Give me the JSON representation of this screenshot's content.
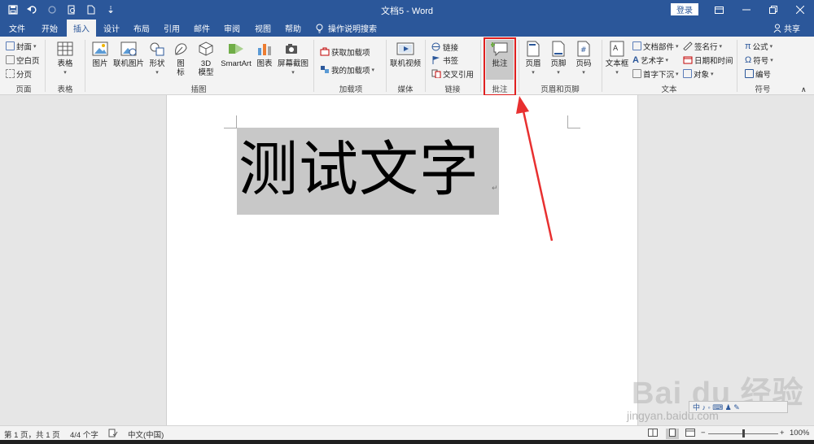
{
  "titlebar": {
    "doc_title": "文档5 - Word",
    "login_label": "登录",
    "qat": {
      "save": "save-icon",
      "undo": "undo-icon",
      "redo": "redo-icon",
      "print_preview": "print-preview-icon",
      "new": "new-doc-icon",
      "customize": "⇣"
    }
  },
  "tabs": [
    {
      "label": "文件",
      "active": false
    },
    {
      "label": "开始",
      "active": false
    },
    {
      "label": "插入",
      "active": true
    },
    {
      "label": "设计",
      "active": false
    },
    {
      "label": "布局",
      "active": false
    },
    {
      "label": "引用",
      "active": false
    },
    {
      "label": "邮件",
      "active": false
    },
    {
      "label": "审阅",
      "active": false
    },
    {
      "label": "视图",
      "active": false
    },
    {
      "label": "帮助",
      "active": false
    }
  ],
  "tell_me": "操作说明搜索",
  "share": "共享",
  "ribbon": {
    "pages": {
      "cover": "封面",
      "blank": "空白页",
      "break": "分页",
      "group": "页面"
    },
    "tables": {
      "table": "表格",
      "group": "表格"
    },
    "illustrations": {
      "picture": "图片",
      "online_picture": "联机图片",
      "shapes": "形状",
      "icons_l1": "图",
      "icons_l2": "标",
      "model_l1": "3D",
      "model_l2": "模型",
      "smartart": "SmartArt",
      "chart": "图表",
      "screenshot": "屏幕截图",
      "group": "插图"
    },
    "addins": {
      "get": "获取加载项",
      "mine": "我的加载项",
      "group": "加载项"
    },
    "media": {
      "online_video": "联机视频",
      "group": "媒体"
    },
    "links": {
      "link": "链接",
      "bookmark": "书签",
      "cross_ref": "交叉引用",
      "group": "链接"
    },
    "comments": {
      "comment": "批注",
      "group": "批注"
    },
    "header_footer": {
      "header": "页眉",
      "footer": "页脚",
      "page_number": "页码",
      "group": "页眉和页脚"
    },
    "text": {
      "textbox": "文本框",
      "quick_parts": "文档部件",
      "wordart": "艺术字",
      "dropcap": "首字下沉",
      "signature": "签名行",
      "datetime": "日期和时间",
      "object": "对象",
      "group": "文本"
    },
    "symbols": {
      "equation": "公式",
      "symbol": "符号",
      "number": "编号",
      "group": "符号"
    }
  },
  "document": {
    "text": "测试文字",
    "para_mark": "↵"
  },
  "watermark": {
    "brand": "Bai du 经验",
    "url": "jingyan.baidu.com",
    "ime": "中 ♪ ◦ ⌨ ♟ ✎"
  },
  "statusbar": {
    "page": "第 1 页，共 1 页",
    "words": "4/4 个字",
    "language": "中文(中国)",
    "zoom_minus": "−",
    "zoom_plus": "+",
    "zoom": "100%",
    "zoom_fraction": 0.5
  },
  "colors": {
    "accent": "#2b579a",
    "highlight": "#e02020",
    "selection": "#c8c8c8"
  }
}
